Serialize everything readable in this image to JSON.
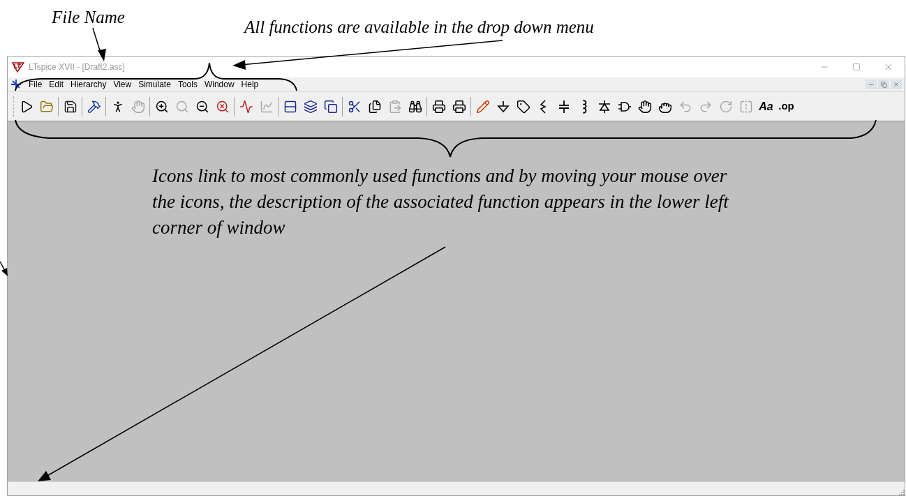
{
  "annotations": [
    {
      "text": "File Name"
    },
    {
      "text": "All functions are available in the drop down menu"
    },
    {
      "text": "Icons link to most commonly used functions and by moving your mouse over the icons, the description of the associated function appears in the lower left corner of window"
    }
  ],
  "window": {
    "title": "LTspice XVII - [Draft2.asc]"
  },
  "menu": [
    {
      "label": "File"
    },
    {
      "label": "Edit"
    },
    {
      "label": "Hierarchy"
    },
    {
      "label": "View"
    },
    {
      "label": "Simulate"
    },
    {
      "label": "Tools"
    },
    {
      "label": "Window"
    },
    {
      "label": "Help"
    }
  ],
  "toolbar": [
    [
      {
        "kind": "run",
        "disabled": false
      },
      {
        "kind": "open",
        "disabled": false
      }
    ],
    [
      {
        "kind": "save",
        "disabled": false
      }
    ],
    [
      {
        "kind": "hammer",
        "disabled": false
      }
    ],
    [
      {
        "kind": "halt",
        "disabled": false
      },
      {
        "kind": "pan",
        "disabled": true
      }
    ],
    [
      {
        "kind": "zoomin",
        "disabled": false
      },
      {
        "kind": "zoomfit",
        "disabled": true
      },
      {
        "kind": "zoomout",
        "disabled": false
      },
      {
        "kind": "zoomcancel",
        "disabled": false
      }
    ],
    [
      {
        "kind": "plot",
        "disabled": false
      },
      {
        "kind": "autorange",
        "disabled": true
      }
    ],
    [
      {
        "kind": "tile",
        "disabled": false
      },
      {
        "kind": "cascade",
        "disabled": false
      },
      {
        "kind": "windows",
        "disabled": false
      }
    ],
    [
      {
        "kind": "cut",
        "disabled": false
      },
      {
        "kind": "copy",
        "disabled": false
      },
      {
        "kind": "paste",
        "disabled": true
      },
      {
        "kind": "find",
        "disabled": false
      }
    ],
    [
      {
        "kind": "printsetup",
        "disabled": false
      },
      {
        "kind": "print",
        "disabled": false
      }
    ],
    [
      {
        "kind": "wire",
        "disabled": false
      },
      {
        "kind": "ground",
        "disabled": false
      },
      {
        "kind": "label",
        "disabled": false
      },
      {
        "kind": "resistor",
        "disabled": false
      },
      {
        "kind": "capacitor",
        "disabled": false
      },
      {
        "kind": "inductor",
        "disabled": false
      },
      {
        "kind": "diode",
        "disabled": false
      },
      {
        "kind": "component",
        "disabled": false
      },
      {
        "kind": "move",
        "disabled": false
      },
      {
        "kind": "drag",
        "disabled": false
      },
      {
        "kind": "undo",
        "disabled": true
      },
      {
        "kind": "redo",
        "disabled": true
      },
      {
        "kind": "rotate",
        "disabled": true
      },
      {
        "kind": "mirror",
        "disabled": true
      },
      {
        "kind": "text",
        "label": "Aa",
        "disabled": false
      },
      {
        "kind": "spice",
        "label": ".op",
        "disabled": false
      }
    ]
  ]
}
